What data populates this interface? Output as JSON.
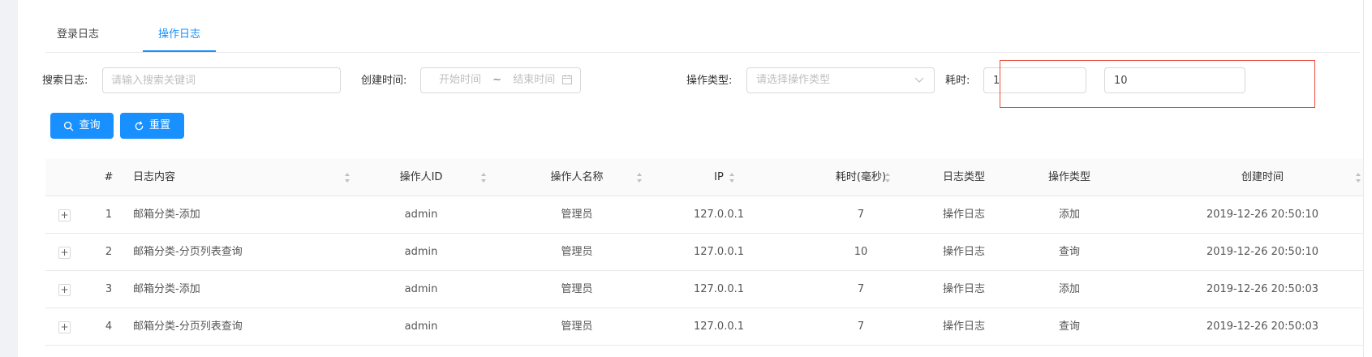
{
  "tabs": [
    {
      "label": "登录日志",
      "active": false
    },
    {
      "label": "操作日志",
      "active": true
    }
  ],
  "search": {
    "log_label": "搜索日志:",
    "log_placeholder": "请输入搜索关键词",
    "created_label": "创建时间:",
    "start_placeholder": "开始时间",
    "range_separator": "~",
    "end_placeholder": "结束时间",
    "op_type_label": "操作类型:",
    "op_type_placeholder": "请选择操作类型",
    "duration_label": "耗时:",
    "duration_min": "1",
    "duration_max": "10"
  },
  "buttons": {
    "query": "查询",
    "reset": "重置"
  },
  "table": {
    "headers": {
      "index": "#",
      "content": "日志内容",
      "operator_id": "操作人ID",
      "operator_name": "操作人名称",
      "ip": "IP",
      "duration": "耗时(毫秒)",
      "log_type": "日志类型",
      "op_type": "操作类型",
      "created": "创建时间"
    },
    "expand_symbol": "+",
    "rows": [
      {
        "index": "1",
        "content": "邮箱分类-添加",
        "operator_id": "admin",
        "operator_name": "管理员",
        "ip": "127.0.0.1",
        "duration": "7",
        "log_type": "操作日志",
        "op_type": "添加",
        "created": "2019-12-26 20:50:10"
      },
      {
        "index": "2",
        "content": "邮箱分类-分页列表查询",
        "operator_id": "admin",
        "operator_name": "管理员",
        "ip": "127.0.0.1",
        "duration": "10",
        "log_type": "操作日志",
        "op_type": "查询",
        "created": "2019-12-26 20:50:10"
      },
      {
        "index": "3",
        "content": "邮箱分类-添加",
        "operator_id": "admin",
        "operator_name": "管理员",
        "ip": "127.0.0.1",
        "duration": "7",
        "log_type": "操作日志",
        "op_type": "添加",
        "created": "2019-12-26 20:50:03"
      },
      {
        "index": "4",
        "content": "邮箱分类-分页列表查询",
        "operator_id": "admin",
        "operator_name": "管理员",
        "ip": "127.0.0.1",
        "duration": "7",
        "log_type": "操作日志",
        "op_type": "查询",
        "created": "2019-12-26 20:50:03"
      }
    ]
  },
  "colors": {
    "primary": "#1890ff",
    "highlight_border": "#e74c3c",
    "header_bg": "#fafafa"
  }
}
